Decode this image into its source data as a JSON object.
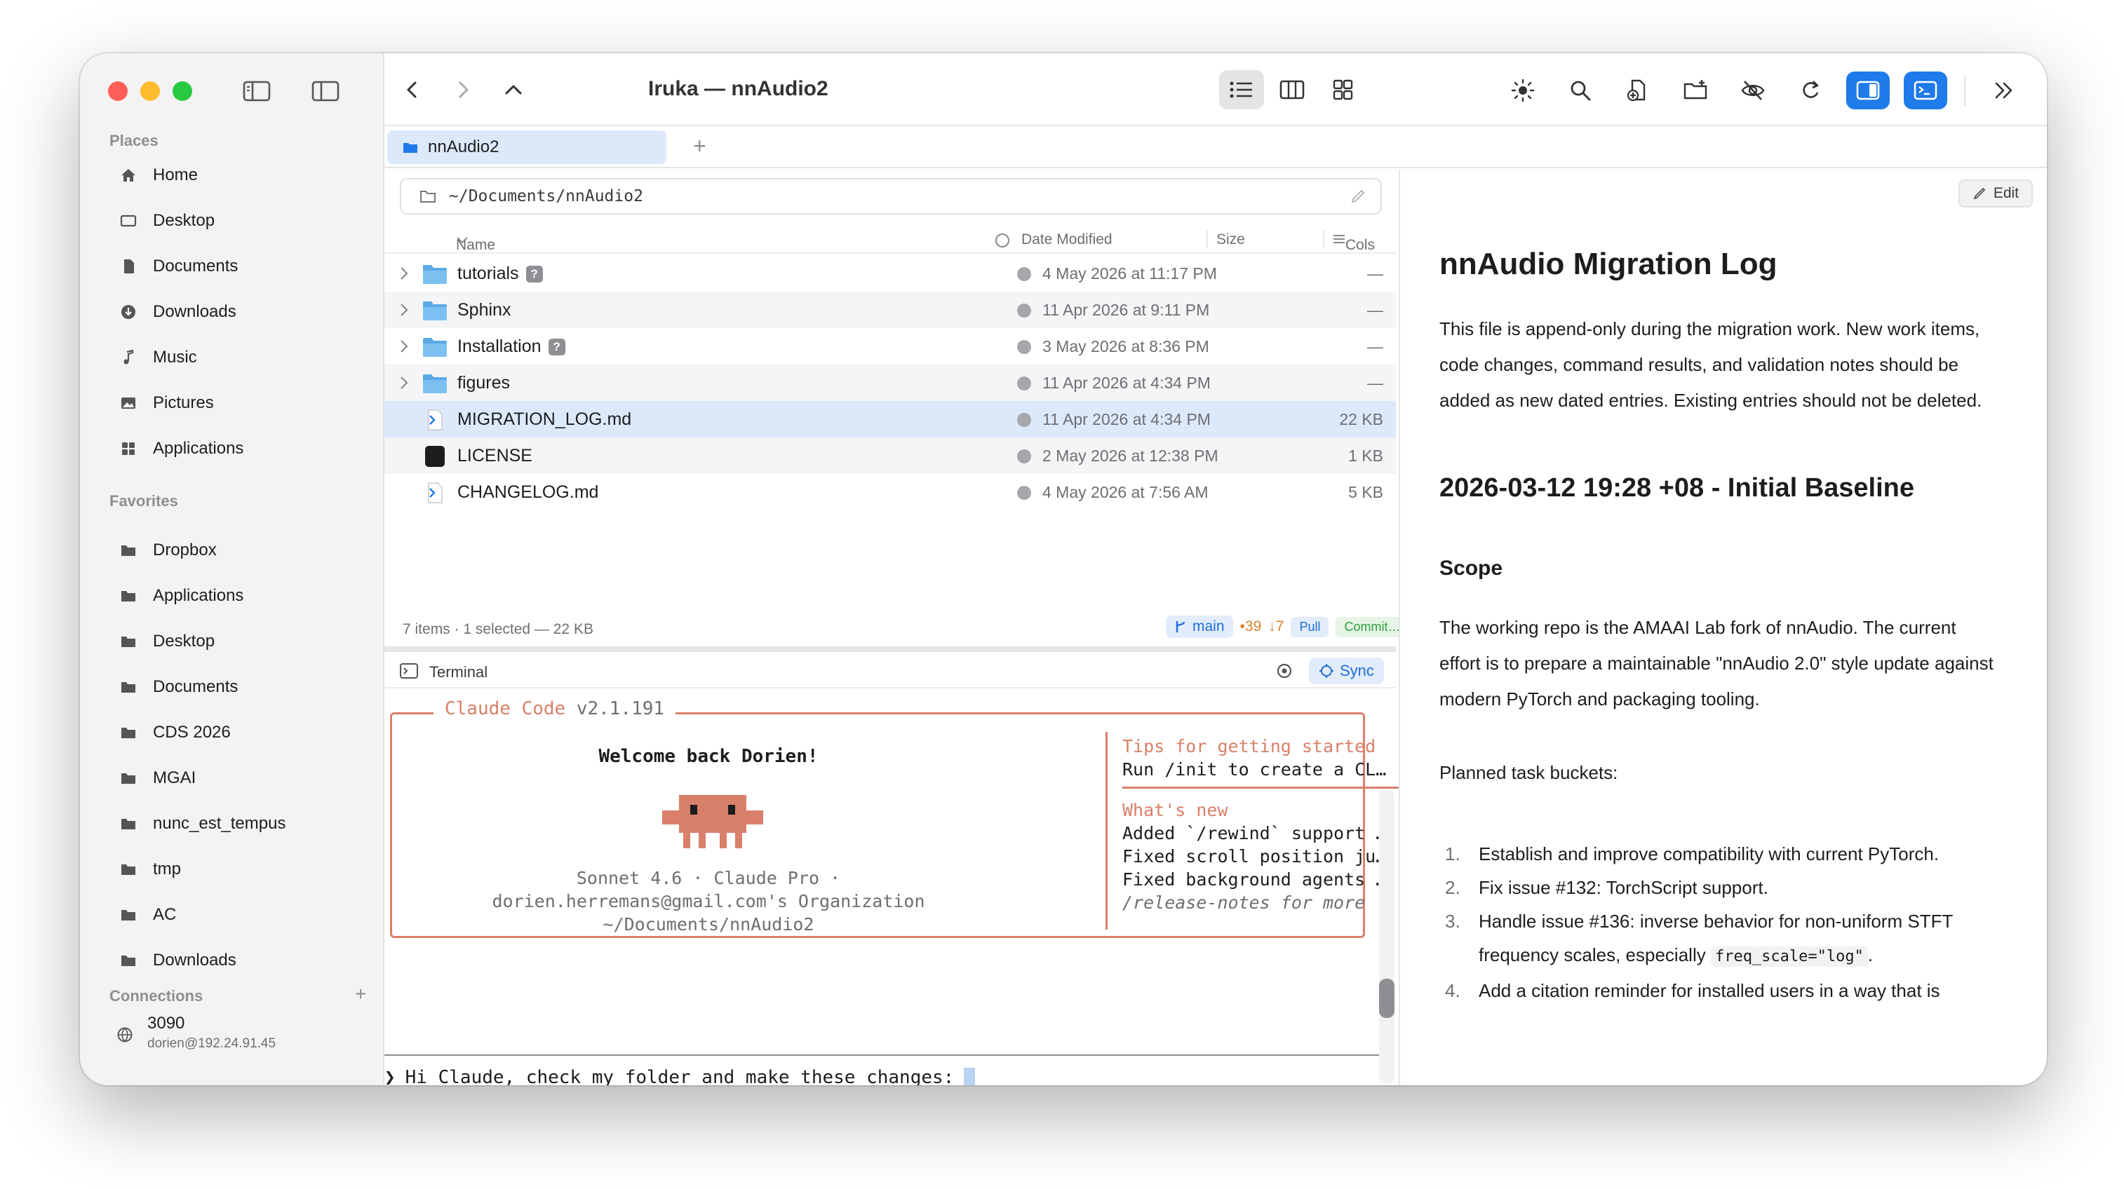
{
  "window": {
    "title": "Iruka — nnAudio2"
  },
  "sidebar": {
    "places_label": "Places",
    "places": [
      {
        "label": "Home",
        "icon": "house-icon"
      },
      {
        "label": "Desktop",
        "icon": "desktop-icon"
      },
      {
        "label": "Documents",
        "icon": "document-icon"
      },
      {
        "label": "Downloads",
        "icon": "download-icon"
      },
      {
        "label": "Music",
        "icon": "music-icon"
      },
      {
        "label": "Pictures",
        "icon": "picture-icon"
      },
      {
        "label": "Applications",
        "icon": "apps-icon"
      }
    ],
    "favorites_label": "Favorites",
    "favorites": [
      {
        "label": "Dropbox"
      },
      {
        "label": "Applications"
      },
      {
        "label": "Desktop"
      },
      {
        "label": "Documents"
      },
      {
        "label": "CDS 2026"
      },
      {
        "label": "MGAI"
      },
      {
        "label": "nunc_est_tempus"
      },
      {
        "label": "tmp"
      },
      {
        "label": "AC"
      },
      {
        "label": "Downloads"
      }
    ],
    "connections_label": "Connections",
    "connections_add": "+",
    "connection": {
      "name": "3090",
      "address": "dorien@192.24.91.45"
    }
  },
  "tabs": {
    "active": "nnAudio2",
    "add": "+"
  },
  "browser": {
    "path": "~/Documents/nnAudio2",
    "columns": {
      "name": "Name",
      "date": "Date Modified",
      "size": "Size",
      "cols": "Cols"
    },
    "files": [
      {
        "name": "tutorials",
        "type": "folder",
        "badge": "?",
        "date": "4 May 2026 at 11:17 PM",
        "size": "—"
      },
      {
        "name": "Sphinx",
        "type": "folder",
        "badge": "",
        "date": "11 Apr 2026 at 9:11 PM",
        "size": "—"
      },
      {
        "name": "Installation",
        "type": "folder",
        "badge": "?",
        "date": "3 May 2026 at 8:36 PM",
        "size": "—"
      },
      {
        "name": "figures",
        "type": "folder",
        "badge": "",
        "date": "11 Apr 2026 at 4:34 PM",
        "size": "—"
      },
      {
        "name": "MIGRATION_LOG.md",
        "type": "markdown",
        "badge": "",
        "date": "11 Apr 2026 at 4:34 PM",
        "size": "22 KB"
      },
      {
        "name": "LICENSE",
        "type": "exec",
        "badge": "",
        "date": "2 May 2026 at 12:38 PM",
        "size": "1 KB"
      },
      {
        "name": "CHANGELOG.md",
        "type": "markdown",
        "badge": "",
        "date": "4 May 2026 at 7:56 AM",
        "size": "5 KB"
      }
    ],
    "status": "7 items  · 1 selected — 22 KB",
    "git": {
      "branch": "main",
      "ahead": "•39",
      "behind": "↓7",
      "pull": "Pull",
      "commit": "Commit…"
    }
  },
  "terminal": {
    "title": "Terminal",
    "sync": "Sync",
    "cc_name": "Claude Code",
    "cc_version": "v2.1.191",
    "welcome": "Welcome back Dorien!",
    "meta_line1": "Sonnet 4.6 · Claude Pro ·",
    "meta_line2": "dorien.herremans@gmail.com's Organization",
    "meta_line3": "~/Documents/nnAudio2",
    "tips_head": "Tips for getting started",
    "tips_line": "Run /init to create a CL…",
    "new_head": "What's new",
    "new_1": "Added `/rewind` support …",
    "new_2": "Fixed scroll position ju…",
    "new_3": "Fixed background agents …",
    "new_more": "/release-notes for more",
    "prompt_symbol": "❯",
    "prompt_text": "Hi Claude, check my folder and make these changes:"
  },
  "preview": {
    "edit": "Edit",
    "h1": "nnAudio Migration Log",
    "intro": "This file is append-only during the migration work. New work items, code changes, command results, and validation notes should be added as new dated entries. Existing entries should not be deleted.",
    "h2": "2026-03-12 19:28 +08 - Initial Baseline",
    "h3": "Scope",
    "scope": "The working repo is the AMAAI Lab fork of nnAudio. The current effort is to prepare a maintainable \"nnAudio 2.0\" style update against modern PyTorch and packaging tooling.",
    "planned": "Planned task buckets:",
    "list": [
      {
        "n": "1.",
        "text": "Establish and improve compatibility with current PyTorch."
      },
      {
        "n": "2.",
        "text": "Fix issue #132: TorchScript support."
      },
      {
        "n": "3.",
        "text": "Handle issue #136: inverse behavior for non-uniform STFT frequency scales, especially ",
        "code": "freq_scale=\"log\"",
        "tail": "."
      },
      {
        "n": "4.",
        "text": "Add a citation reminder for installed users in a way that is"
      }
    ]
  },
  "colors": {
    "accent": "#1f7aea",
    "claude_orange": "#d9806a",
    "selection": "#dce9fb",
    "folder": "#5aa9e6"
  }
}
